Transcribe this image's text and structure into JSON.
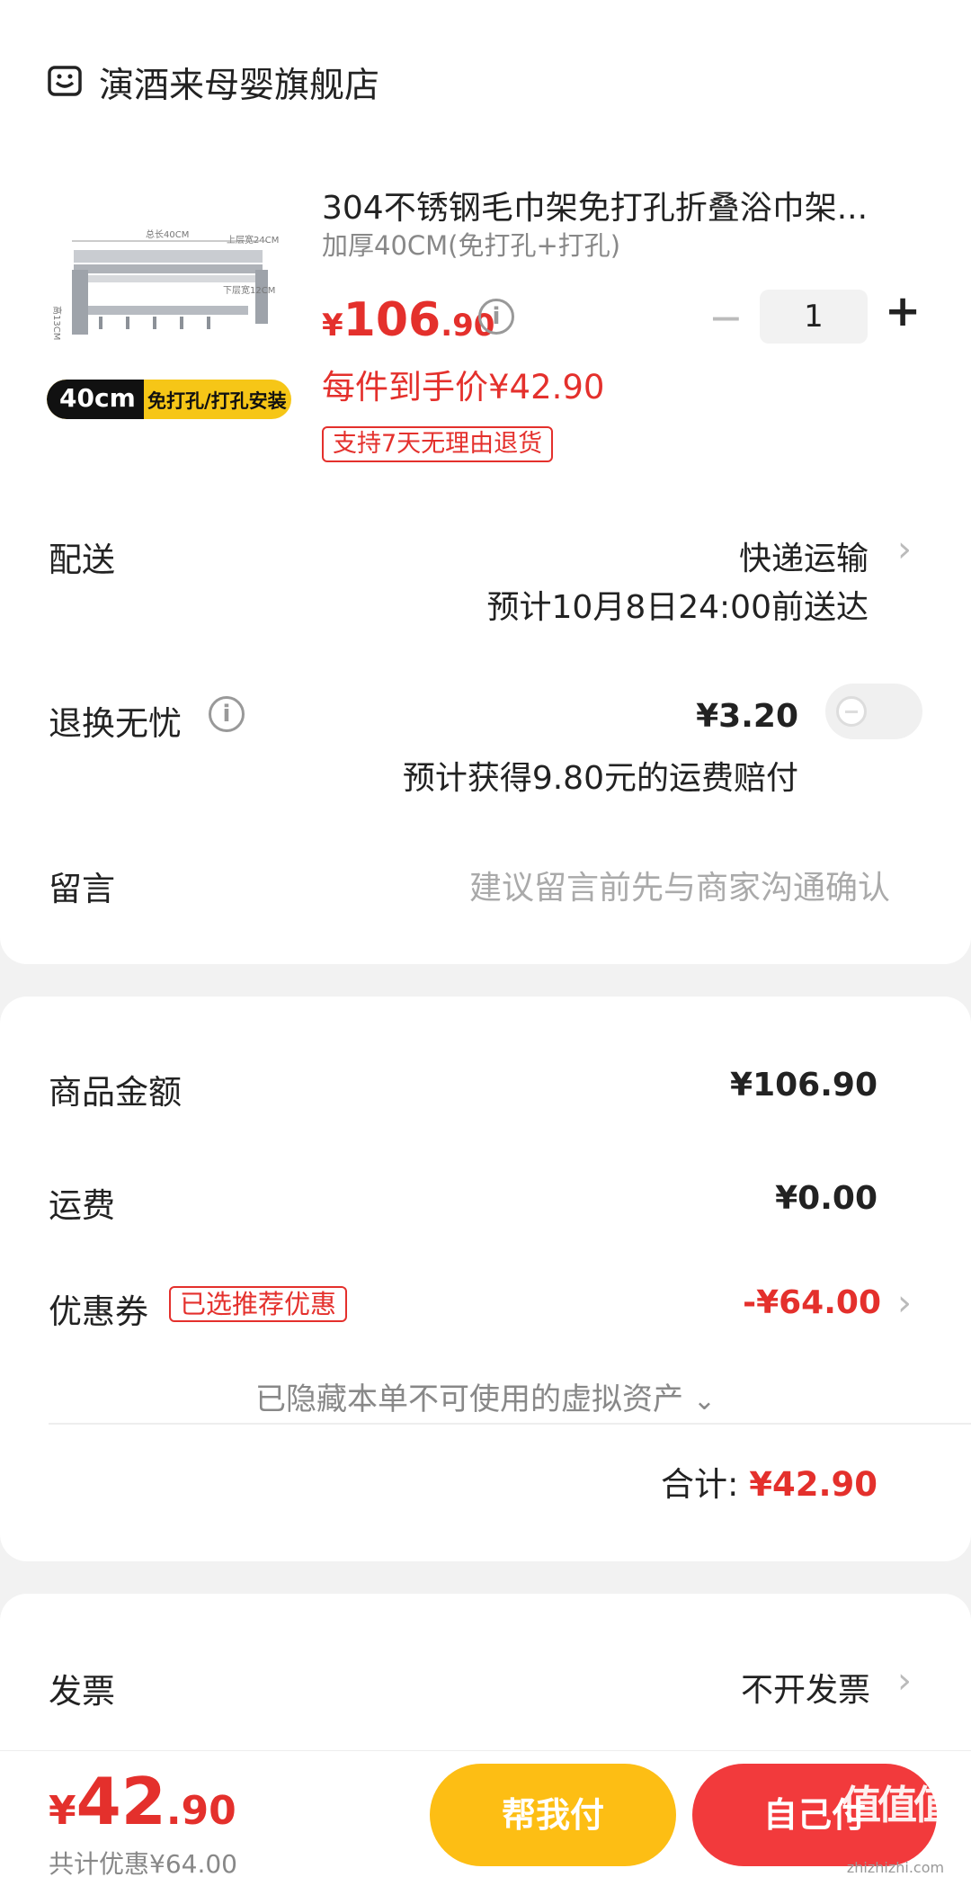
{
  "shop": {
    "name": "演酒来母婴旗舰店",
    "icon": "shop-icon"
  },
  "product": {
    "title": "304不锈钢毛巾架免打孔折叠浴巾架...",
    "spec": "加厚40CM(免打孔+打孔)",
    "price_symbol": "¥",
    "price_int": "106",
    "price_dec": ".90",
    "unit_price_line": "每件到手价¥42.90",
    "return_tag": "支持7天无理由退货",
    "image_labels": {
      "size": "40cm",
      "install": "免打孔/打孔安装",
      "dim_top": "总长40CM",
      "dim_width": "上层宽24CM",
      "dim_lower": "下层宽12CM",
      "dim_height": "高13CM"
    },
    "quantity": "1",
    "minus": "−",
    "plus": "+"
  },
  "delivery": {
    "label": "配送",
    "method": "快递运输",
    "eta": "预计10月8日24:00前送达"
  },
  "return_insurance": {
    "label": "退换无忧",
    "price": "¥3.20",
    "note": "预计获得9.80元的运费赔付",
    "enabled": false
  },
  "message": {
    "label": "留言",
    "placeholder": "建议留言前先与商家沟通确认"
  },
  "summary": {
    "goods_label": "商品金额",
    "goods_value": "¥106.90",
    "shipping_label": "运费",
    "shipping_value": "¥0.00",
    "coupon_label": "优惠券",
    "coupon_tag": "已选推荐优惠",
    "coupon_value": "-¥64.00",
    "hidden_assets": "已隐藏本单不可使用的虚拟资产",
    "total_label": "合计:",
    "total_value": "¥42.90"
  },
  "invoice": {
    "label": "发票",
    "value": "不开发票"
  },
  "bottom_bar": {
    "price_symbol": "¥",
    "price_int": "42",
    "price_dec": ".90",
    "discount_note": "共计优惠¥64.00",
    "help_pay": "帮我付",
    "self_pay": "自己付",
    "watermark": "值值值",
    "watermark_url": "zhizhizhi.com"
  },
  "colors": {
    "accent_red": "#e4302c",
    "help_pay_yellow": "#fdbe14",
    "self_pay_red": "#f23a3c"
  }
}
